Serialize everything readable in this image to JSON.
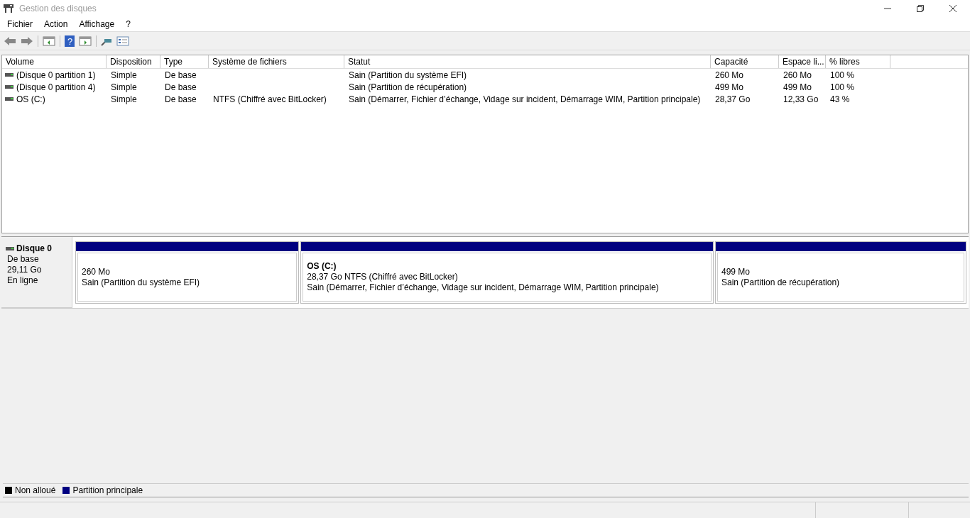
{
  "window": {
    "title": "Gestion des disques"
  },
  "menu": [
    "Fichier",
    "Action",
    "Affichage",
    "?"
  ],
  "toolbar": {
    "help_glyph": "?"
  },
  "table": {
    "columns": [
      "Volume",
      "Disposition",
      "Type",
      "Système de fichiers",
      "Statut",
      "Capacité",
      "Espace li...",
      "% libres"
    ],
    "rows": [
      [
        "(Disque 0 partition 1)",
        "Simple",
        "De base",
        null,
        "Sain (Partition du système EFI)",
        "260 Mo",
        "260 Mo",
        "100 %"
      ],
      [
        "(Disque 0 partition 4)",
        "Simple",
        "De base",
        null,
        "Sain (Partition de récupération)",
        "499 Mo",
        "499 Mo",
        "100 %"
      ],
      [
        "OS (C:)",
        "Simple",
        "De base",
        "NTFS (Chiffré avec BitLocker)",
        "Sain (Démarrer, Fichier d’échange, Vidage sur incident, Démarrage WIM, Partition principale)",
        "28,37 Go",
        "12,33 Go",
        "43 %"
      ]
    ]
  },
  "disk": {
    "name": "Disque 0",
    "type": "De base",
    "size": "29,11 Go",
    "state": "En ligne",
    "partitions": [
      {
        "size": "260 Mo",
        "status": "Sain (Partition du système EFI)",
        "color": "#000080"
      },
      {
        "name": "OS  (C:)",
        "size": "28,37 Go NTFS (Chiffré avec BitLocker)",
        "status": "Sain (Démarrer, Fichier d’échange, Vidage sur incident, Démarrage WIM, Partition principale)",
        "color": "#000080"
      },
      {
        "size": "499 Mo",
        "status": "Sain (Partition de récupération)",
        "color": "#000080"
      }
    ]
  },
  "legend": [
    {
      "label": "Non alloué",
      "color": "#000000"
    },
    {
      "label": "Partition principale",
      "color": "#000080"
    }
  ]
}
